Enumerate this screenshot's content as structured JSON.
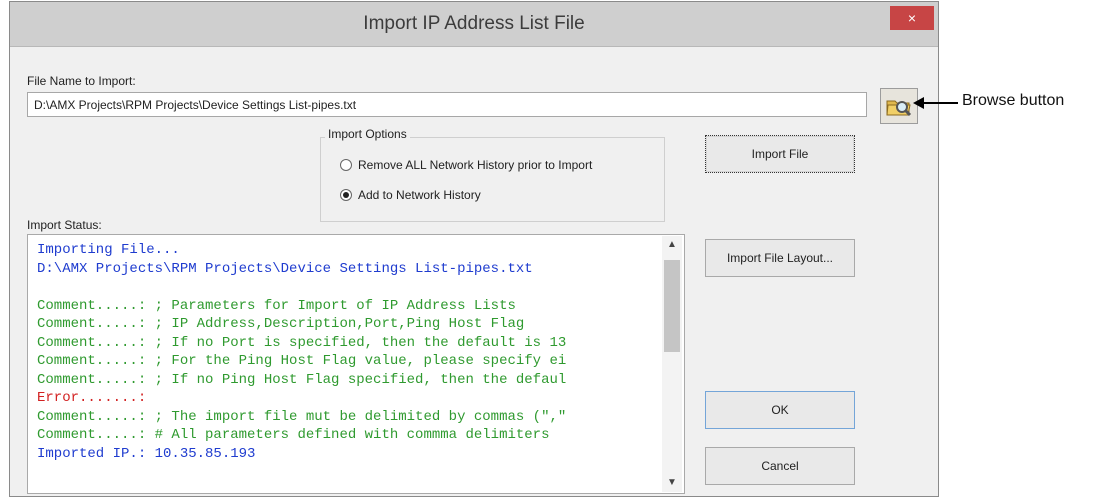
{
  "dialog": {
    "title": "Import IP Address List File",
    "close_label": "×",
    "file_name_label": "File Name to Import:",
    "file_name_value": "D:\\AMX Projects\\RPM Projects\\Device Settings List-pipes.txt",
    "import_options": {
      "title": "Import Options",
      "options": [
        {
          "label": "Remove ALL Network History prior to Import",
          "selected": false
        },
        {
          "label": "Add to Network History",
          "selected": true
        }
      ]
    },
    "import_status_label": "Import Status:",
    "buttons": {
      "import_file": "Import File",
      "import_file_layout": "Import File Layout...",
      "ok": "OK",
      "cancel": "Cancel"
    },
    "status_log": [
      {
        "text": "Importing File...",
        "color": "#1f3ccf"
      },
      {
        "text": "D:\\AMX Projects\\RPM Projects\\Device Settings List-pipes.txt",
        "color": "#1f3ccf"
      },
      {
        "text": "",
        "color": "#1f3ccf"
      },
      {
        "text": "Comment.....: ; Parameters for Import of IP Address Lists",
        "color": "#2f9a2f"
      },
      {
        "text": "Comment.....: ; IP Address,Description,Port,Ping Host Flag",
        "color": "#2f9a2f"
      },
      {
        "text": "Comment.....: ; If no Port is specified, then the default is 13",
        "color": "#2f9a2f"
      },
      {
        "text": "Comment.....: ; For the Ping Host Flag value, please specify ei",
        "color": "#2f9a2f"
      },
      {
        "text": "Comment.....: ; If no Ping Host Flag specified, then the defaul",
        "color": "#2f9a2f"
      },
      {
        "text": "Error.......:",
        "color": "#d22121"
      },
      {
        "text": "Comment.....: ; The import file mut be delimited by commas (\",\"",
        "color": "#2f9a2f"
      },
      {
        "text": "Comment.....: # All parameters defined with commma delimiters",
        "color": "#2f9a2f"
      },
      {
        "text": "Imported IP.: 10.35.85.193",
        "color": "#1f3ccf"
      }
    ]
  },
  "annotation": {
    "label": "Browse button"
  },
  "icons": {
    "browse": "folder-search-icon",
    "close": "close-icon"
  }
}
